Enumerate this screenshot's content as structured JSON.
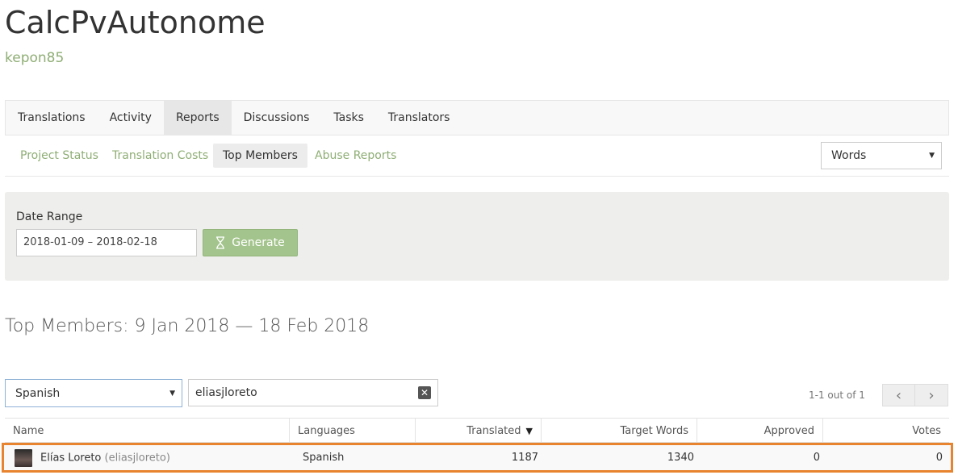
{
  "project": {
    "title": "CalcPvAutonome",
    "owner": "kepon85"
  },
  "tabs": [
    {
      "label": "Translations"
    },
    {
      "label": "Activity"
    },
    {
      "label": "Reports"
    },
    {
      "label": "Discussions"
    },
    {
      "label": "Tasks"
    },
    {
      "label": "Translators"
    }
  ],
  "subtabs": [
    {
      "label": "Project Status"
    },
    {
      "label": "Translation Costs"
    },
    {
      "label": "Top Members"
    },
    {
      "label": "Abuse Reports"
    }
  ],
  "metric_select": {
    "value": "Words"
  },
  "date_panel": {
    "label": "Date Range",
    "range_value": "2018-01-09 – 2018-02-18",
    "generate_label": "Generate"
  },
  "heading": "Top Members: 9 Jan 2018 — 18 Feb 2018",
  "filters": {
    "language": "Spanish",
    "search_value": "eliasjloreto"
  },
  "pagination": {
    "info": "1-1 out of 1"
  },
  "table": {
    "columns": [
      "Name",
      "Languages",
      "Translated",
      "Target Words",
      "Approved",
      "Votes"
    ],
    "rows": [
      {
        "name": "Elías Loreto",
        "username": "(eliasjloreto)",
        "languages": "Spanish",
        "translated": "1187",
        "target_words": "1340",
        "approved": "0",
        "votes": "0"
      }
    ]
  },
  "colors": {
    "accent_green": "#8fae75",
    "button_green": "#a3c48c",
    "highlight_orange": "#e8832f"
  }
}
